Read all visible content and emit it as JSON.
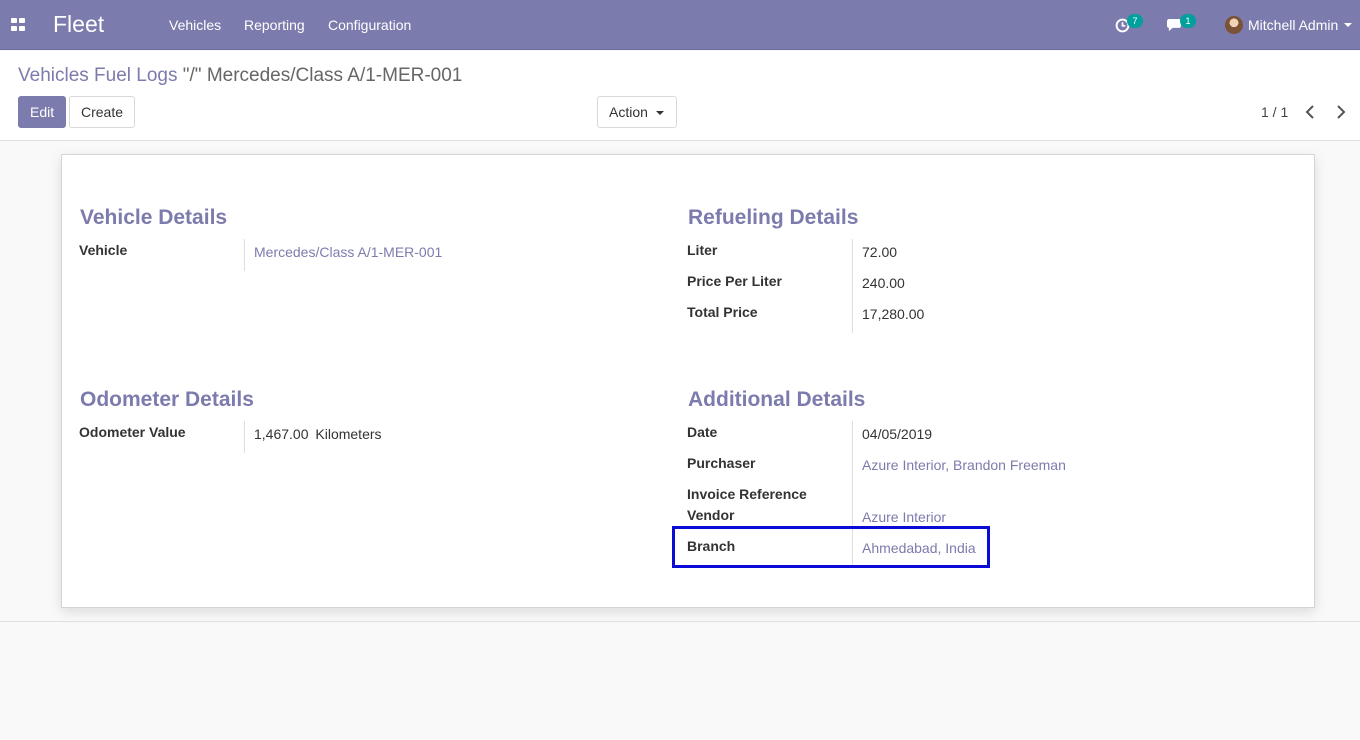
{
  "navbar": {
    "app_name": "Fleet",
    "menu": [
      "Vehicles",
      "Reporting",
      "Configuration"
    ],
    "activity_count": "7",
    "message_count": "1",
    "user_name": "Mitchell Admin",
    "accent_color": "#7c7bad",
    "badge_color": "#00a09d"
  },
  "breadcrumb": {
    "parent": "Vehicles Fuel Logs",
    "current": "\"/\" Mercedes/Class A/1-MER-001"
  },
  "buttons": {
    "edit": "Edit",
    "create": "Create",
    "action": "Action"
  },
  "pager": {
    "text": "1 / 1"
  },
  "form": {
    "vehicle_details": {
      "title": "Vehicle Details",
      "vehicle_label": "Vehicle",
      "vehicle_value": "Mercedes/Class A/1-MER-001"
    },
    "refueling_details": {
      "title": "Refueling Details",
      "liter_label": "Liter",
      "liter_value": "72.00",
      "price_per_liter_label": "Price Per Liter",
      "price_per_liter_value": "240.00",
      "total_price_label": "Total Price",
      "total_price_value": "17,280.00"
    },
    "odometer_details": {
      "title": "Odometer Details",
      "odometer_label": "Odometer Value",
      "odometer_value": "1,467.00",
      "odometer_unit": "Kilometers"
    },
    "additional_details": {
      "title": "Additional Details",
      "date_label": "Date",
      "date_value": "04/05/2019",
      "purchaser_label": "Purchaser",
      "purchaser_value": "Azure Interior, Brandon Freeman",
      "invoice_reference_label": "Invoice Reference",
      "vendor_label": "Vendor",
      "vendor_value": "Azure Interior",
      "branch_label": "Branch",
      "branch_value": "Ahmedabad, India"
    }
  },
  "highlight_color": "#0b0bd6"
}
